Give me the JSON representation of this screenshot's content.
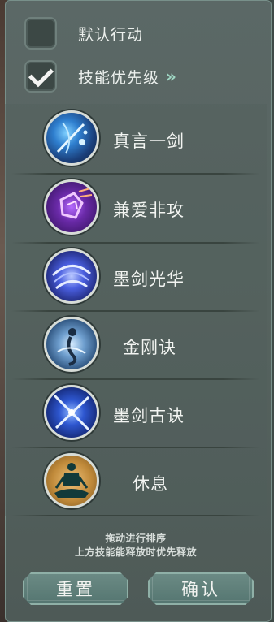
{
  "options": [
    {
      "label": "默认行动",
      "checked": false
    },
    {
      "label": "技能优先级",
      "checked": true,
      "chevron": "»"
    }
  ],
  "skills": [
    {
      "label": "真言一剑",
      "icon": "water-sword-icon",
      "color": "#1f5a9e"
    },
    {
      "label": "兼爱非攻",
      "icon": "purple-shield-icon",
      "color": "#6a2a9e"
    },
    {
      "label": "墨剑光华",
      "icon": "swirl-icon",
      "color": "#2b3fae"
    },
    {
      "label": "金刚诀",
      "icon": "figure-icon",
      "color": "#3a5f86"
    },
    {
      "label": "墨剑古诀",
      "icon": "crossed-swords-icon",
      "color": "#1b3a9a"
    },
    {
      "label": "休息",
      "icon": "meditation-icon",
      "color": "#c08a3a"
    }
  ],
  "hint": {
    "line1": "拖动进行排序",
    "line2": "上方技能能释放时优先释放"
  },
  "buttons": {
    "reset": "重置",
    "confirm": "确认"
  }
}
